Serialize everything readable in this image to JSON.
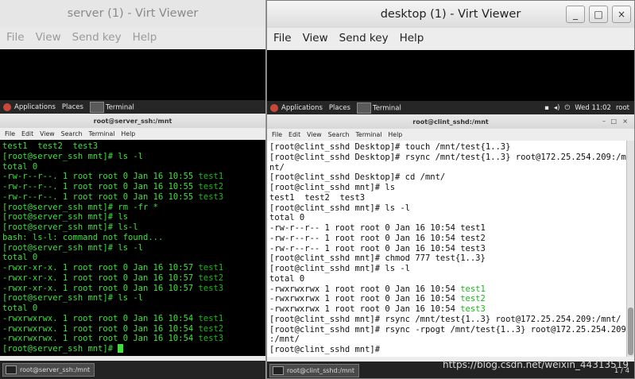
{
  "left_window": {
    "title": "server (1) - Virt Viewer",
    "menu": [
      "File",
      "View",
      "Send key",
      "Help"
    ],
    "panel": {
      "applications": "Applications",
      "places": "Places",
      "terminal": "Terminal"
    },
    "terminal_title": "root@server_ssh:/mnt",
    "terminal_menu": [
      "File",
      "Edit",
      "View",
      "Search",
      "Terminal",
      "Help"
    ],
    "lines": [
      {
        "a": "test1  test2  test3",
        "b": ""
      },
      {
        "a": "[root@server_ssh mnt]# ls -l",
        "b": ""
      },
      {
        "a": "total 0",
        "b": ""
      },
      {
        "a": "-rw-r--r--. 1 root root 0 Jan 16 10:55 ",
        "b": "test1"
      },
      {
        "a": "-rw-r--r--. 1 root root 0 Jan 16 10:55 ",
        "b": "test2"
      },
      {
        "a": "-rw-r--r--. 1 root root 0 Jan 16 10:55 ",
        "b": "test3"
      },
      {
        "a": "[root@server_ssh mnt]# rm -fr *",
        "b": ""
      },
      {
        "a": "[root@server_ssh mnt]# ls",
        "b": ""
      },
      {
        "a": "[root@server_ssh mnt]# ls-l",
        "b": ""
      },
      {
        "a": "bash: ls-l: command not found...",
        "b": ""
      },
      {
        "a": "[root@server_ssh mnt]# ls -l",
        "b": ""
      },
      {
        "a": "total 0",
        "b": ""
      },
      {
        "a": "-rwxr-xr-x. 1 root root 0 Jan 16 10:57 ",
        "b": "test1"
      },
      {
        "a": "-rwxr-xr-x. 1 root root 0 Jan 16 10:57 ",
        "b": "test2"
      },
      {
        "a": "-rwxr-xr-x. 1 root root 0 Jan 16 10:57 ",
        "b": "test3"
      },
      {
        "a": "[root@server_ssh mnt]# ls -l",
        "b": ""
      },
      {
        "a": "total 0",
        "b": ""
      },
      {
        "a": "-rwxrwxrwx. 1 root root 0 Jan 16 10:54 ",
        "b": "test1"
      },
      {
        "a": "-rwxrwxrwx. 1 root root 0 Jan 16 10:54 ",
        "b": "test2"
      },
      {
        "a": "-rwxrwxrwx. 1 root root 0 Jan 16 10:54 ",
        "b": "test3"
      }
    ],
    "prompt": "[root@server_ssh mnt]# ",
    "task": "root@server_ssh:/mnt"
  },
  "right_window": {
    "title": "desktop (1) - Virt Viewer",
    "controls": {
      "minimize": "_",
      "maximize": "□",
      "close": "×"
    },
    "menu": [
      "File",
      "View",
      "Send key",
      "Help"
    ],
    "panel": {
      "applications": "Applications",
      "places": "Places",
      "terminal": "Terminal",
      "clock": "Wed 11:02",
      "user": "root"
    },
    "terminal_title": "root@clint_sshd:/mnt",
    "terminal_menu": [
      "File",
      "Edit",
      "View",
      "Search",
      "Terminal",
      "Help"
    ],
    "lines": [
      {
        "a": "[root@clint_sshd Desktop]# touch /mnt/test{1..3}",
        "b": ""
      },
      {
        "a": "[root@clint_sshd Desktop]# rsync /mnt/test{1..3} root@172.25.254.209:/m",
        "b": ""
      },
      {
        "a": "nt/",
        "b": ""
      },
      {
        "a": "[root@clint_sshd Desktop]# cd /mnt/",
        "b": ""
      },
      {
        "a": "[root@clint_sshd mnt]# ls",
        "b": ""
      },
      {
        "a": "test1  test2  test3",
        "b": ""
      },
      {
        "a": "[root@clint_sshd mnt]# ls -l",
        "b": ""
      },
      {
        "a": "total 0",
        "b": ""
      },
      {
        "a": "-rw-r--r-- 1 root root 0 Jan 16 10:54 test1",
        "b": ""
      },
      {
        "a": "-rw-r--r-- 1 root root 0 Jan 16 10:54 test2",
        "b": ""
      },
      {
        "a": "-rw-r--r-- 1 root root 0 Jan 16 10:54 test3",
        "b": ""
      },
      {
        "a": "[root@clint_sshd mnt]# chmod 777 test{1..3}",
        "b": ""
      },
      {
        "a": "[root@clint_sshd mnt]# ls -l",
        "b": ""
      },
      {
        "a": "total 0",
        "b": ""
      },
      {
        "a": "-rwxrwxrwx 1 root root 0 Jan 16 10:54 ",
        "b": "test1"
      },
      {
        "a": "-rwxrwxrwx 1 root root 0 Jan 16 10:54 ",
        "b": "test2"
      },
      {
        "a": "-rwxrwxrwx 1 root root 0 Jan 16 10:54 ",
        "b": "test3"
      },
      {
        "a": "[root@clint_sshd mnt]# rsync /mnt/test{1..3} root@172.25.254.209:/mnt/",
        "b": ""
      },
      {
        "a": "[root@clint_sshd mnt]# rsync -rpogt /mnt/test{1..3} root@172.25.254.209",
        "b": ""
      },
      {
        "a": ":/mnt/",
        "b": ""
      },
      {
        "a": "[root@clint_sshd mnt]#",
        "b": ""
      }
    ],
    "task": "root@clint_sshd:/mnt",
    "pager": "1 / 4"
  },
  "watermark": "https://blog.csdn.net/weixin_44313519"
}
